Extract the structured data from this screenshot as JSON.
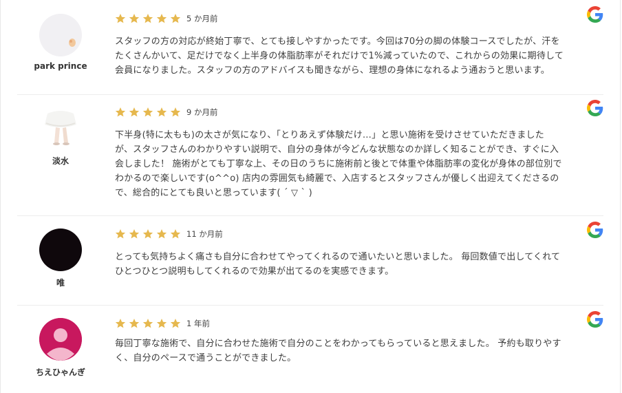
{
  "reviews": [
    {
      "name": "park prince",
      "time": "5 か月前",
      "rating": 5,
      "avatar": "photo-avatar",
      "lines": [
        "スタッフの方の対応が終始丁寧で、とても接しやすかったです。今回は70分の脚の体験コースでしたが、汗を",
        "たくさんかいて、足だけでなく上半身の体脂肪率がそれだけで1%減っていたので、これからの効果に期待して",
        "会員になりました。スタッフの方のアドバイスも聞きながら、理想の身体になれるよう通おうと思います。"
      ]
    },
    {
      "name": "淡水",
      "time": "9 か月前",
      "rating": 5,
      "avatar": "photo-avatar",
      "lines": [
        "下半身(特に太もも)の太さが気になり、「とりあえず体験だけ…」と思い施術を受けさせていただきました",
        "が、スタッフさんのわかりやすい説明で、自分の身体が今どんな状態なのか詳しく知ることができ、すぐに入",
        "会しました！ 施術がとても丁寧な上、その日のうちに施術前と後とで体重や体脂肪率の変化が身体の部位別で",
        "わかるので楽しいです(o^^o) 店内の雰囲気も綺麗で、入店するとスタッフさんが優しく出迎えてくださるの",
        "で、総合的にとても良いと思っています( ´ ▽ ` )"
      ]
    },
    {
      "name": "唯",
      "time": "11 か月前",
      "rating": 5,
      "avatar": "dark-avatar",
      "lines": [
        "とっても気持ちよく痛さも自分に合わせてやってくれるので通いたいと思いました。 毎回数値で出してくれて",
        "ひとつひとつ説明もしてくれるので効果が出てるのを実感できます。"
      ]
    },
    {
      "name": "ちえひゃんぎ",
      "time": "1 年前",
      "rating": 5,
      "avatar": "default-person-avatar",
      "lines": [
        "毎回丁寧な施術で、自分に合わせた施術で自分のことをわかってもらっていると思えました。 予約も取りやす",
        "く、自分のペースで通うことができました。"
      ]
    }
  ],
  "colors": {
    "star": "#E6B84E",
    "avatar_pink": "#C8185E",
    "avatar_dark": "#0F080C"
  },
  "icons": {
    "source": "google-g-icon"
  }
}
